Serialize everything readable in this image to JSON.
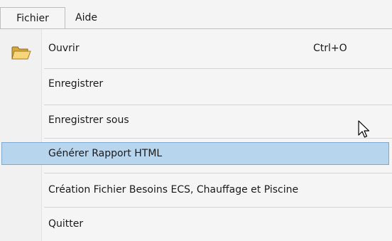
{
  "menubar": {
    "items": [
      {
        "label": "Fichier",
        "open": true
      },
      {
        "label": "Aide",
        "open": false
      }
    ]
  },
  "menu": {
    "items": [
      {
        "label": "Ouvrir",
        "shortcut": "Ctrl+O",
        "icon": "folder-open-icon"
      },
      {
        "label": "Enregistrer"
      },
      {
        "label": "Enregistrer sous"
      },
      {
        "label": "Générer Rapport HTML",
        "highlighted": true
      },
      {
        "label": "Création Fichier Besoins ECS, Chauffage et Piscine"
      },
      {
        "label": "Quitter"
      }
    ]
  },
  "colors": {
    "highlight_fill": "#b8d5ee",
    "highlight_border": "#7fa8ce",
    "menu_background": "#f5f5f5"
  }
}
